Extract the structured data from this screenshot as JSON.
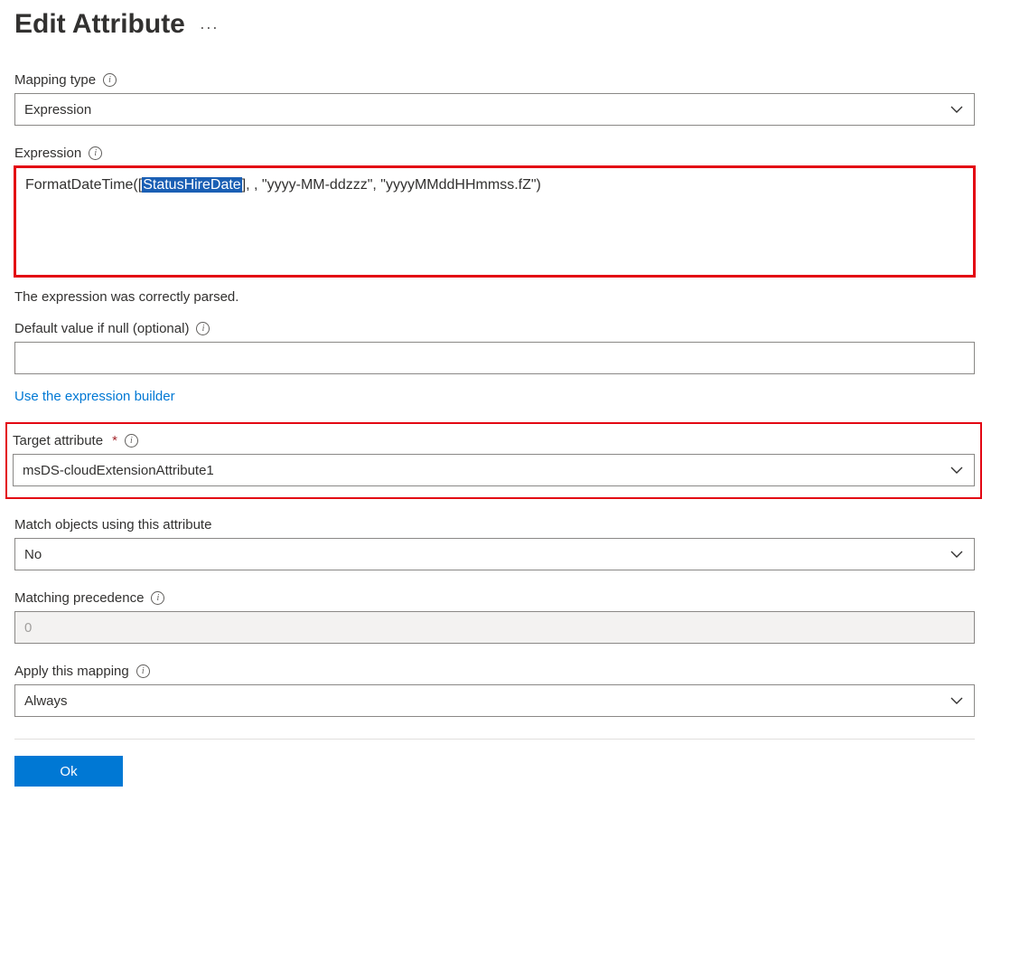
{
  "header": {
    "title": "Edit Attribute"
  },
  "mapping_type": {
    "label": "Mapping type",
    "value": "Expression"
  },
  "expression": {
    "label": "Expression",
    "prefix": "FormatDateTime([",
    "selected": "StatusHireDate",
    "suffix": "], , \"yyyy-MM-ddzzz\", \"yyyyMMddHHmmss.fZ\")",
    "status": "The expression was correctly parsed."
  },
  "default_value": {
    "label": "Default value if null (optional)",
    "value": ""
  },
  "links": {
    "expression_builder": "Use the expression builder"
  },
  "target_attribute": {
    "label": "Target attribute",
    "value": "msDS-cloudExtensionAttribute1"
  },
  "match_objects": {
    "label": "Match objects using this attribute",
    "value": "No"
  },
  "matching_precedence": {
    "label": "Matching precedence",
    "value": "0"
  },
  "apply_mapping": {
    "label": "Apply this mapping",
    "value": "Always"
  },
  "buttons": {
    "ok": "Ok"
  }
}
